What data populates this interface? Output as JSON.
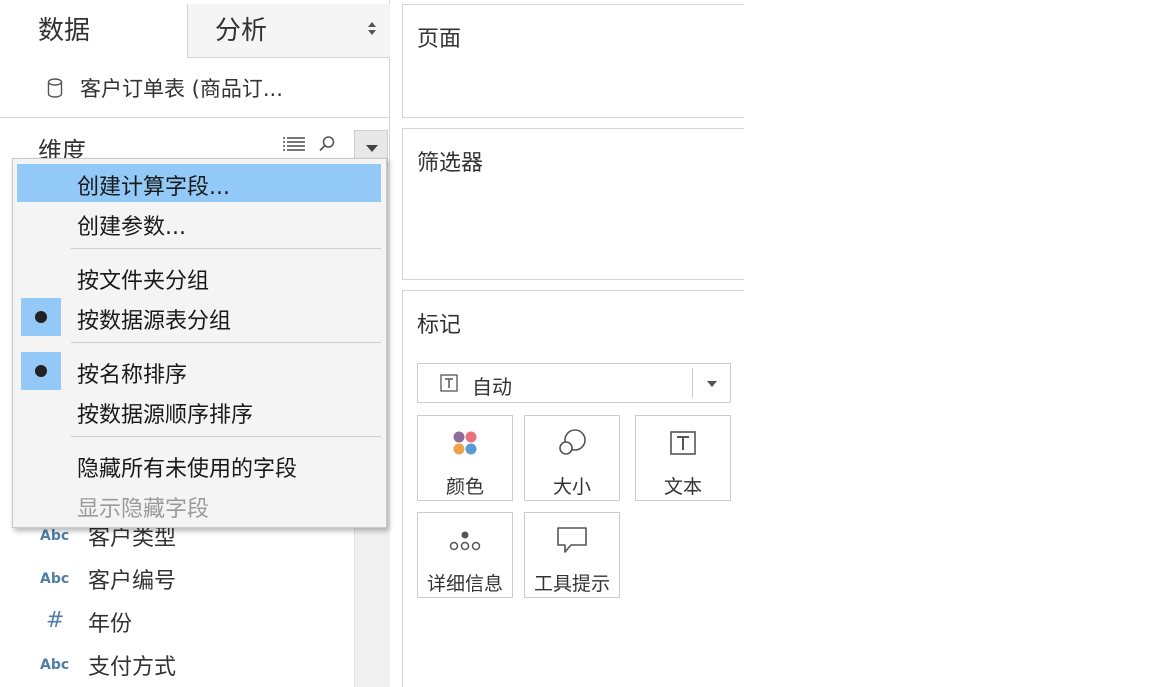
{
  "tabs": {
    "data": "数据",
    "analysis": "分析"
  },
  "datasource": {
    "label": "客户订单表 (商品订..."
  },
  "dimensions": {
    "title": "维度"
  },
  "context_menu": {
    "items": [
      {
        "label": "创建计算字段...",
        "highlighted": true
      },
      {
        "label": "创建参数..."
      },
      {
        "label": "按文件夹分组"
      },
      {
        "label": "按数据源表分组",
        "checked": true
      },
      {
        "label": "按名称排序",
        "checked": true
      },
      {
        "label": "按数据源顺序排序"
      },
      {
        "label": "隐藏所有未使用的字段"
      },
      {
        "label": "显示隐藏字段",
        "disabled": true
      }
    ]
  },
  "fields": [
    {
      "type": "Abc",
      "name": "客户类型"
    },
    {
      "type": "Abc",
      "name": "客户编号"
    },
    {
      "type": "#",
      "name": "年份"
    },
    {
      "type": "Abc",
      "name": "支付方式"
    }
  ],
  "shelves": {
    "pages": "页面",
    "filters": "筛选器",
    "marks": "标记"
  },
  "marks": {
    "type_label": "自动",
    "buttons": [
      {
        "label": "颜色",
        "icon": "color-icon"
      },
      {
        "label": "大小",
        "icon": "size-icon"
      },
      {
        "label": "文本",
        "icon": "text-icon"
      },
      {
        "label": "详细信息",
        "icon": "detail-icon"
      },
      {
        "label": "工具提示",
        "icon": "tooltip-icon"
      }
    ]
  },
  "colors": {
    "highlight": "#92c9f7",
    "field_type": "#4f7fa5"
  }
}
